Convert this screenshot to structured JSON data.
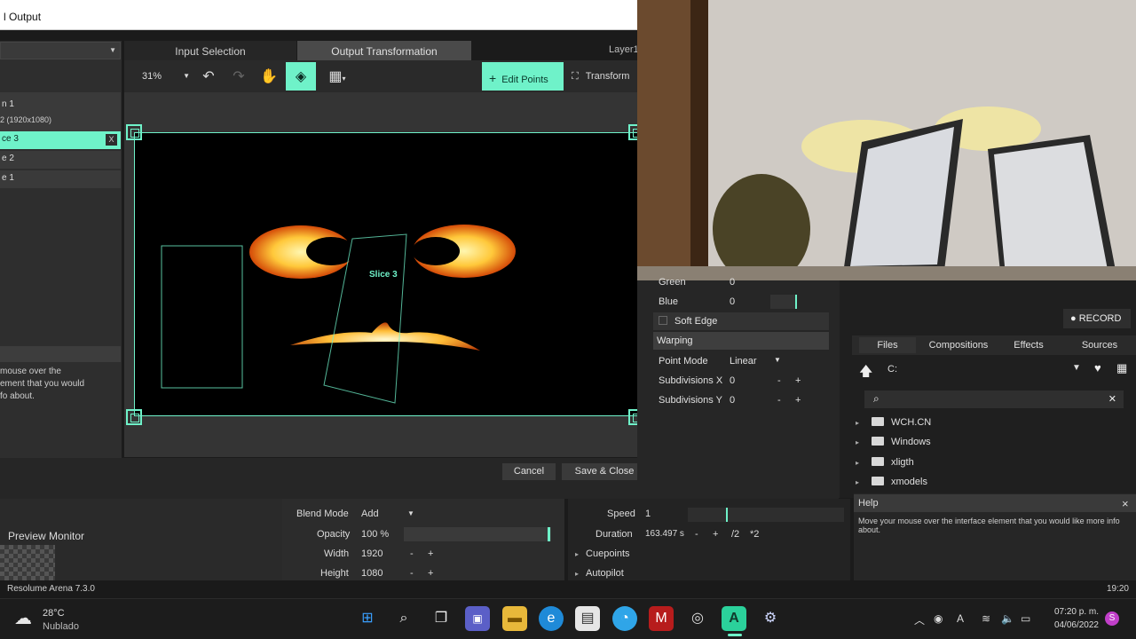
{
  "window": {
    "title": "l Output",
    "tabs": {
      "input": "Input Selection",
      "output": "Output Transformation"
    },
    "layer": "Layer1",
    "zoom": "31%",
    "edit_points": "Edit Points",
    "transform": "Transform",
    "cancel": "Cancel",
    "save_close": "Save & Close"
  },
  "left_list": {
    "screen_title": "n 1",
    "screen_res": "2 (1920x1080)",
    "items": [
      "ce 3",
      "e 2",
      "e 1"
    ],
    "selected_index": 0,
    "remove": "X",
    "help": [
      "mouse over the",
      "ement that you would",
      "fo about."
    ]
  },
  "canvas": {
    "slice_label": "Slice 3"
  },
  "params": {
    "green": {
      "label": "Green",
      "value": "0"
    },
    "blue": {
      "label": "Blue",
      "value": "0"
    },
    "soft_edge": "Soft Edge",
    "warping": "Warping",
    "point_mode": {
      "label": "Point Mode",
      "value": "Linear"
    },
    "subdiv_x": {
      "label": "Subdivisions X",
      "value": "0"
    },
    "subdiv_y": {
      "label": "Subdivisions Y",
      "value": "0"
    },
    "minus": "-",
    "plus": "+"
  },
  "record": "RECORD",
  "files_panel": {
    "tabs": [
      "Files",
      "Compositions",
      "Effects",
      "Sources"
    ],
    "path": "C:",
    "folders": [
      "WCH.CN",
      "Windows",
      "xligth",
      "xmodels"
    ]
  },
  "bottom": {
    "preview_monitor": "Preview Monitor",
    "blend_mode": {
      "label": "Blend Mode",
      "value": "Add"
    },
    "opacity": {
      "label": "Opacity",
      "value": "100 %"
    },
    "width": {
      "label": "Width",
      "value": "1920"
    },
    "height": {
      "label": "Height",
      "value": "1080"
    },
    "speed": {
      "label": "Speed",
      "value": "1"
    },
    "duration": {
      "label": "Duration",
      "value": "163.497 s",
      "half": "/2",
      "double": "*2"
    },
    "cuepoints": "Cuepoints",
    "autopilot": "Autopilot"
  },
  "help": {
    "title": "Help",
    "text": "Move your mouse over the interface element that you would like more info about.",
    "close": "×"
  },
  "status": {
    "app": "Resolume Arena 7.3.0",
    "time": "19:20"
  },
  "taskbar": {
    "temp": "28°C",
    "weather": "Nublado",
    "clock_time": "07:20 p. m.",
    "clock_date": "04/06/2022",
    "user_initial": "S"
  },
  "colors": {
    "accent": "#6ff2c9",
    "record_dot": "#ffffff"
  }
}
